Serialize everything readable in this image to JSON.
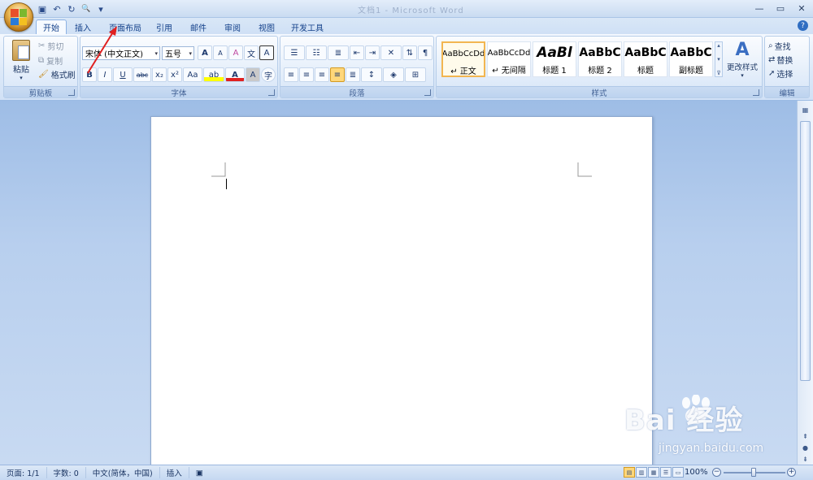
{
  "app": {
    "title": "文档1 - Microsoft Word"
  },
  "quick_access": [
    {
      "name": "save-icon",
      "glyph": "▣"
    },
    {
      "name": "undo-icon",
      "glyph": "↶"
    },
    {
      "name": "redo-icon",
      "glyph": "↻"
    },
    {
      "name": "print-preview-icon",
      "glyph": "🔍"
    },
    {
      "name": "customize-qat-icon",
      "glyph": "▾"
    }
  ],
  "window_controls": {
    "minimize": "—",
    "restore": "▭",
    "close": "✕"
  },
  "tabs": [
    "开始",
    "插入",
    "页面布局",
    "引用",
    "邮件",
    "审阅",
    "视图",
    "开发工具"
  ],
  "ribbon": {
    "clipboard": {
      "label": "剪贴板",
      "paste": "粘贴",
      "cut": "剪切",
      "copy": "复制",
      "format_painter": "格式刷"
    },
    "font": {
      "label": "字体",
      "font_name": "宋体 (中文正文)",
      "font_size": "五号",
      "grow": "A",
      "shrink": "A",
      "bold": "B",
      "italic": "I",
      "underline": "U",
      "strikethrough": "abc",
      "subscript": "x₂",
      "superscript": "x²",
      "change_case": "Aa",
      "font_color": "A",
      "char_shading": "A",
      "enclose": "字",
      "phonetic": "文",
      "clear_format": "A"
    },
    "paragraph": {
      "label": "段落"
    },
    "styles": {
      "label": "样式",
      "items": [
        {
          "sample": "AaBbCcDd",
          "name": "↵ 正文"
        },
        {
          "sample": "AaBbCcDd",
          "name": "↵ 无间隔"
        },
        {
          "sample": "AaBl",
          "name": "标题 1"
        },
        {
          "sample": "AaBbC",
          "name": "标题 2"
        },
        {
          "sample": "AaBbC",
          "name": "标题"
        },
        {
          "sample": "AaBbC",
          "name": "副标题"
        }
      ],
      "change_styles": "更改样式"
    },
    "editing": {
      "label": "编辑",
      "find": "查找",
      "replace": "替换",
      "select": "选择"
    }
  },
  "status": {
    "page": "页面: 1/1",
    "words": "字数: 0",
    "language": "中文(简体，中国)",
    "mode": "插入",
    "zoom": "100%"
  },
  "watermark": {
    "brand": "Bai 经验",
    "url": "jingyan.baidu.com"
  },
  "colors": {
    "accent": "#15428b",
    "arrow": "#e02020",
    "selected_style": "#f2b650"
  }
}
